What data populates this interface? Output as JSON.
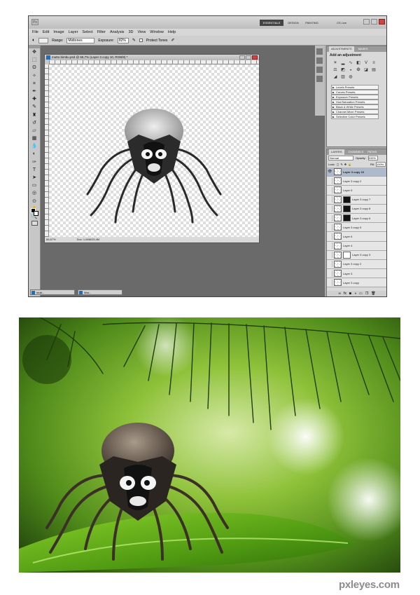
{
  "app": {
    "workspace_buttons": [
      "ESSENTIALS",
      "DESIGN",
      "PAINTING"
    ],
    "cs_live": "CS Live",
    "menu": [
      "File",
      "Edit",
      "Image",
      "Layer",
      "Select",
      "Filter",
      "Analysis",
      "3D",
      "View",
      "Window",
      "Help"
    ],
    "options": {
      "range_label": "Range:",
      "range_value": "Midtones",
      "exposure_label": "Exposure:",
      "exposure_value": "82%",
      "protect_tones": "Protect Tones"
    }
  },
  "document": {
    "title": "mutto bimbu.psd @ 66,7% (Layer 3 copy 10, RGB/8) *",
    "zoom": "66,67%",
    "doc_info": "Doc: 1,66M/25,4M"
  },
  "taskbar": [
    "mutt...",
    "Wor..."
  ],
  "adjustments": {
    "tabs": [
      "ADJUSTMENTS",
      "MASKS"
    ],
    "title": "Add an adjustment",
    "presets": [
      "Levels Presets",
      "Curves Presets",
      "Exposure Presets",
      "Hue/Saturation Presets",
      "Black & White Presets",
      "Channel Mixer Presets",
      "Selective Color Presets"
    ]
  },
  "layers_panel": {
    "tabs": [
      "LAYERS",
      "CHANNELS",
      "PATHS"
    ],
    "blend_mode": "Normal",
    "opacity_label": "Opacity:",
    "opacity": "100%",
    "lock_label": "Lock:",
    "fill_label": "Fill:",
    "fill": "100%",
    "layers": [
      "Layer 3 copy 10",
      "Layer 3 copy 2",
      "Layer 5",
      "Layer 3 copy 7",
      "Layer 3 copy 8",
      "Layer 3 copy 6",
      "Layer 3 copy 5",
      "Layer 6",
      "Layer 4",
      "Layer 3 copy 3",
      "Layer 3 copy 2",
      "Layer 3",
      "Layer 3 copy"
    ]
  },
  "watermark": "pxleyes.com",
  "colors": {
    "selection": "#aeb9cc",
    "photoshop_gray": "#6a6a6a",
    "leaf_green": "#6aa51e"
  }
}
